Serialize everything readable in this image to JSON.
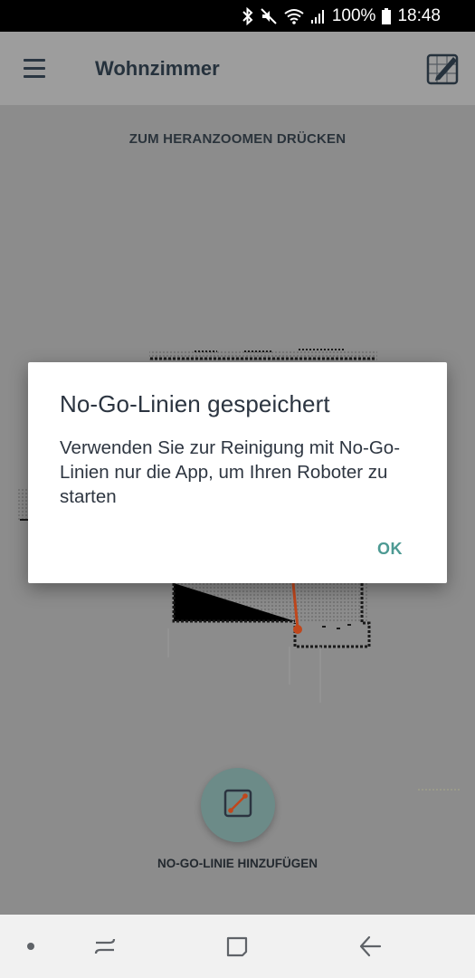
{
  "status_bar": {
    "battery": "100%",
    "time": "18:48",
    "icons": [
      "bluetooth-icon",
      "mute-icon",
      "wifi-icon",
      "signal-icon",
      "battery-icon"
    ]
  },
  "app_bar": {
    "title": "Wohnzimmer",
    "menu_icon": "hamburger-menu-icon",
    "edit_icon": "edit-map-icon"
  },
  "map": {
    "zoom_hint": "ZUM HERANZOOMEN DRÜCKEN"
  },
  "nogo": {
    "button_icon": "nogo-line-icon",
    "label": "NO-GO-LINIE HINZUFÜGEN"
  },
  "dialog": {
    "title": "No-Go-Linien gespeichert",
    "body": "Verwenden Sie zur Reinigung mit No-Go-Linien nur die App, um Ihren Roboter zu starten",
    "ok_label": "OK"
  },
  "nav_bar": {
    "icons": [
      "dot-icon",
      "recent-apps-icon",
      "home-icon",
      "back-icon"
    ]
  },
  "colors": {
    "accent": "#4d9a93",
    "nogo_line": "#c0471c",
    "title_text": "#2b3440"
  }
}
